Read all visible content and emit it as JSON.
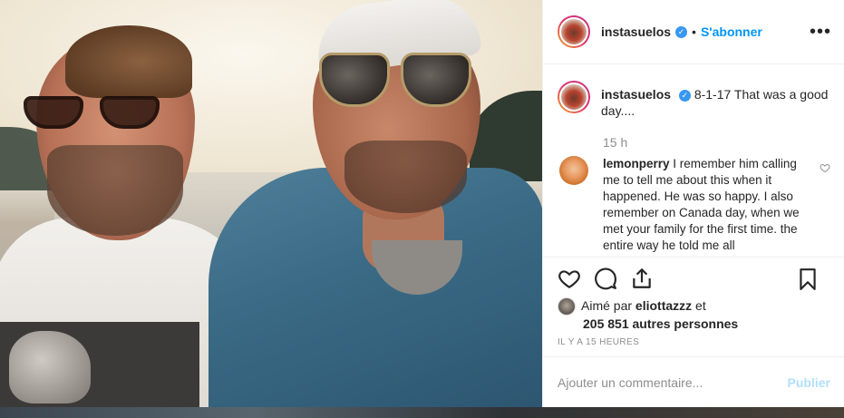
{
  "post": {
    "username": "instasuelos",
    "dot": "•",
    "follow_label": "S'abonner",
    "more_label": "•••"
  },
  "caption": {
    "username": "instasuelos",
    "text": "8-1-17 That was a good day...."
  },
  "timestamp": "15 h",
  "comments": [
    {
      "username": "lemonperry",
      "text": "I remember him calling me to tell me about this when it happened. He was so happy. I also remember on Canada day, when we met your family for the first time. the entire way he told me all"
    }
  ],
  "likes": {
    "prefix": "Aimé par",
    "liker": "eliottazzz",
    "connector": "et",
    "others": "205 851 autres personnes"
  },
  "date_label": "IL Y A 15 HEURES",
  "add_comment": {
    "placeholder": "Ajouter un commentaire...",
    "publish_label": "Publier"
  },
  "colors": {
    "accent": "#0095f6",
    "publish_disabled": "#b2dffc",
    "verified": "#3897f0"
  },
  "icons": [
    "verified-icon",
    "more-icon",
    "heart-icon",
    "comment-icon",
    "share-icon",
    "bookmark-icon",
    "heart-small-icon"
  ]
}
